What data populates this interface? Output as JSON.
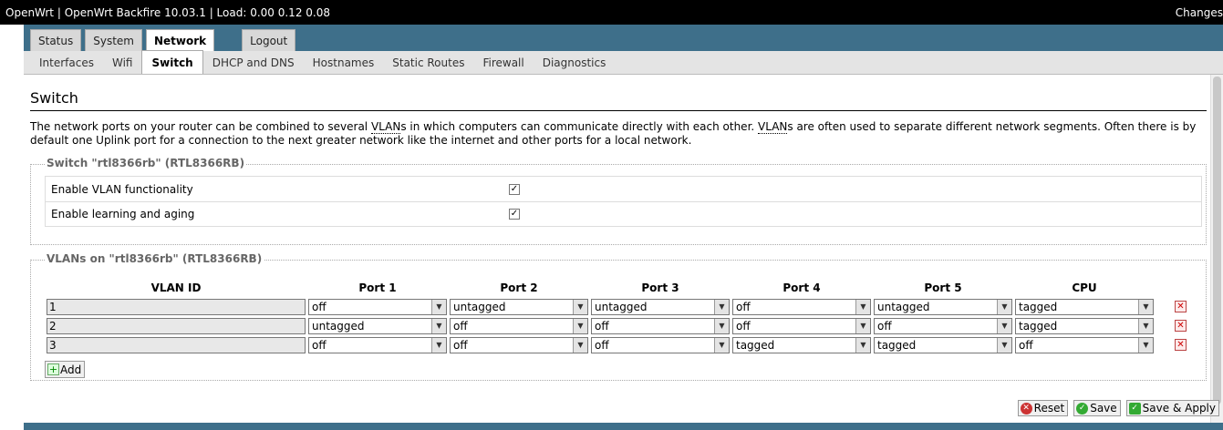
{
  "header": {
    "title": "OpenWrt | OpenWrt Backfire 10.03.1 | Load: 0.00 0.12 0.08",
    "changes": "Changes"
  },
  "main_tabs": [
    {
      "label": "Status",
      "active": false
    },
    {
      "label": "System",
      "active": false
    },
    {
      "label": "Network",
      "active": true
    },
    {
      "label": "Logout",
      "active": false
    }
  ],
  "sub_tabs": [
    {
      "label": "Interfaces",
      "active": false
    },
    {
      "label": "Wifi",
      "active": false
    },
    {
      "label": "Switch",
      "active": true
    },
    {
      "label": "DHCP and DNS",
      "active": false
    },
    {
      "label": "Hostnames",
      "active": false
    },
    {
      "label": "Static Routes",
      "active": false
    },
    {
      "label": "Firewall",
      "active": false
    },
    {
      "label": "Diagnostics",
      "active": false
    }
  ],
  "page": {
    "title": "Switch",
    "desc_1": "The network ports on your router can be combined to several ",
    "desc_vlan1": "VLAN",
    "desc_2": "s in which computers can communicate directly with each other. ",
    "desc_vlan2": "VLAN",
    "desc_3": "s are often used to separate different network segments. Often there is by default one Uplink port for a connection to the next greater network like the internet and other ports for a local network."
  },
  "switch_section": {
    "legend": "Switch \"rtl8366rb\" (RTL8366RB)",
    "options": [
      {
        "label": "Enable VLAN functionality",
        "checked": true,
        "mark": "✓"
      },
      {
        "label": "Enable learning and aging",
        "checked": true,
        "mark": "✓"
      }
    ]
  },
  "vlan_section": {
    "legend": "VLANs on \"rtl8366rb\" (RTL8366RB)",
    "columns": [
      "VLAN ID",
      "Port 1",
      "Port 2",
      "Port 3",
      "Port 4",
      "Port 5",
      "CPU"
    ],
    "rows": [
      {
        "id": "1",
        "ports": [
          "off",
          "untagged",
          "untagged",
          "off",
          "untagged",
          "tagged"
        ]
      },
      {
        "id": "2",
        "ports": [
          "untagged",
          "off",
          "off",
          "off",
          "off",
          "tagged"
        ]
      },
      {
        "id": "3",
        "ports": [
          "off",
          "off",
          "off",
          "tagged",
          "tagged",
          "off"
        ]
      }
    ],
    "add_label": "Add"
  },
  "actions": {
    "reset": "Reset",
    "save": "Save",
    "save_apply": "Save & Apply"
  },
  "icons": {
    "dropdown": "▼",
    "delete": "✕",
    "add": "+",
    "reset": "✕",
    "save": "✓",
    "apply": "✓"
  }
}
